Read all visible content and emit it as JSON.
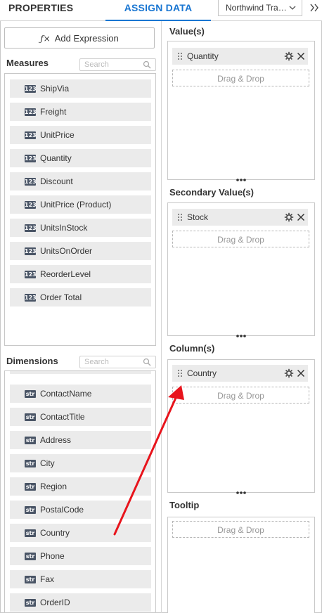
{
  "header": {
    "tab_properties": "PROPERTIES",
    "tab_assign_data": "ASSIGN DATA",
    "datasource_selected": "Northwind Tra…"
  },
  "left": {
    "add_expression_label": "Add Expression",
    "measures": {
      "title": "Measures",
      "search_placeholder": "Search",
      "items": [
        "ShipVia",
        "Freight",
        "UnitPrice",
        "Quantity",
        "Discount",
        "UnitPrice (Product)",
        "UnitsInStock",
        "UnitsOnOrder",
        "ReorderLevel",
        "Order Total"
      ],
      "badge": "123"
    },
    "dimensions": {
      "title": "Dimensions",
      "search_placeholder": "Search",
      "items": [
        "ContactName",
        "ContactTitle",
        "Address",
        "City",
        "Region",
        "PostalCode",
        "Country",
        "Phone",
        "Fax",
        "OrderID"
      ],
      "badge": "str"
    }
  },
  "right": {
    "values": {
      "title": "Value(s)",
      "chip": "Quantity",
      "drop": "Drag & Drop"
    },
    "secondary": {
      "title": "Secondary Value(s)",
      "chip": "Stock",
      "drop": "Drag & Drop"
    },
    "columns": {
      "title": "Column(s)",
      "chip": "Country",
      "drop": "Drag & Drop"
    },
    "tooltip": {
      "title": "Tooltip",
      "drop": "Drag & Drop"
    }
  },
  "colors": {
    "accent": "#1976d2",
    "arrow": "#e8141c",
    "badge": "#4a5566",
    "chip": "#ebebeb"
  },
  "icons": [
    "fx-icon",
    "search-icon",
    "chevron-down-icon",
    "double-chevron-right-icon",
    "grip-icon",
    "gear-icon",
    "close-icon",
    "resize-handle-icon",
    "arrow-annotation"
  ]
}
